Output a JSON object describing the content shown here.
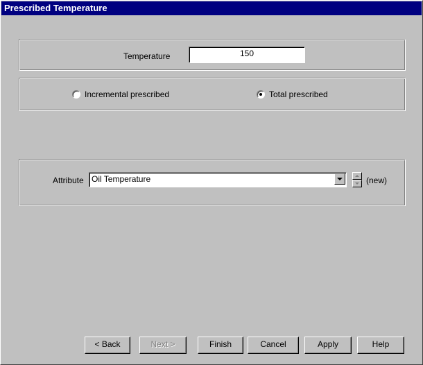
{
  "window": {
    "title": "Prescribed Temperature"
  },
  "temperature": {
    "label": "Temperature",
    "value": "150"
  },
  "mode": {
    "options": [
      {
        "label": "Incremental prescribed",
        "selected": false
      },
      {
        "label": "Total prescribed",
        "selected": true
      }
    ]
  },
  "attribute": {
    "label": "Attribute",
    "value": "Oil Temperature",
    "suffix": "(new)"
  },
  "buttons": {
    "back": "< Back",
    "next": "Next >",
    "finish": "Finish",
    "cancel": "Cancel",
    "apply": "Apply",
    "help": "Help"
  }
}
